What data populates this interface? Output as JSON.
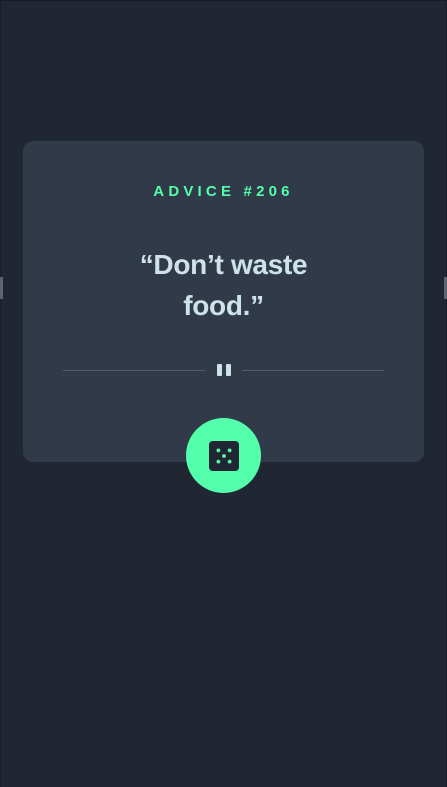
{
  "advice": {
    "label": "ADVICE #206",
    "quote": "“Don’t waste food.”"
  },
  "colors": {
    "background": "#202733",
    "card": "#313a49",
    "accent": "#53ffaa",
    "text": "#cee3e9",
    "divider": "#4f5d74"
  },
  "icons": {
    "divider": "pause-icon",
    "button": "dice-icon"
  }
}
